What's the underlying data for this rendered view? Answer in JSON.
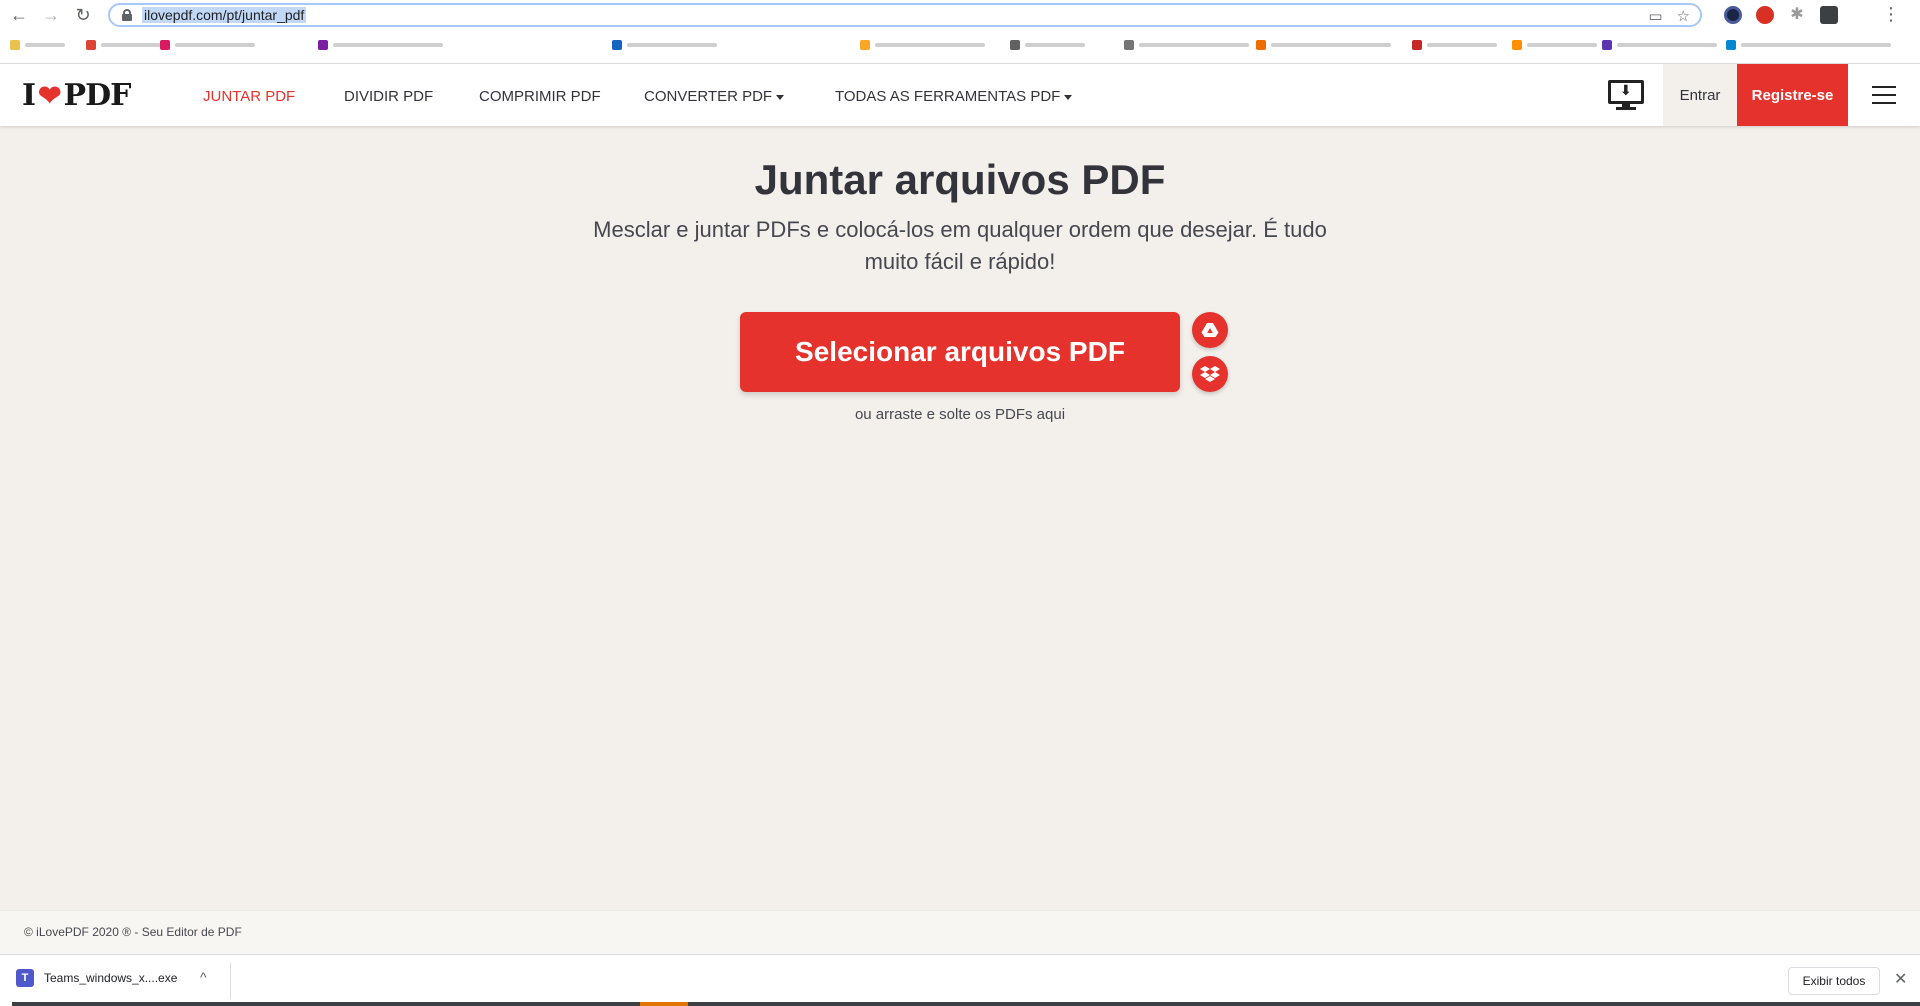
{
  "browser": {
    "url": "ilovepdf.com/pt/juntar_pdf",
    "back_icon": "←",
    "forward_icon": "→",
    "reload_icon": "↻",
    "star_icon": "☆",
    "cast_icon": "▭",
    "kebab_icon": "⋮"
  },
  "site": {
    "logo_left": "I",
    "logo_heart": "❤",
    "logo_right": "PDF",
    "nav": {
      "merge": "JUNTAR PDF",
      "split": "DIVIDIR PDF",
      "compress": "COMPRIMIR PDF",
      "convert": "CONVERTER PDF",
      "all_tools": "TODAS AS FERRAMENTAS PDF"
    },
    "download_arrow": "⬇",
    "login": "Entrar",
    "signup": "Registre-se"
  },
  "main": {
    "title": "Juntar arquivos PDF",
    "subtitle": "Mesclar e juntar PDFs e colocá-los em qualquer ordem que desejar. É tudo muito fácil e rápido!",
    "select_button": "Selecionar arquivos PDF",
    "drop_hint": "ou arraste e solte os PDFs aqui"
  },
  "footer": {
    "text": "© iLovePDF 2020 ® - Seu Editor de PDF"
  },
  "download_bar": {
    "file_name": "Teams_windows_x....exe",
    "teams_glyph": "T",
    "chevron": "^",
    "show_all": "Exibir todos",
    "close": "✕"
  },
  "colors": {
    "brand_red": "#e5322d",
    "page_bg": "#f3f0ec"
  }
}
